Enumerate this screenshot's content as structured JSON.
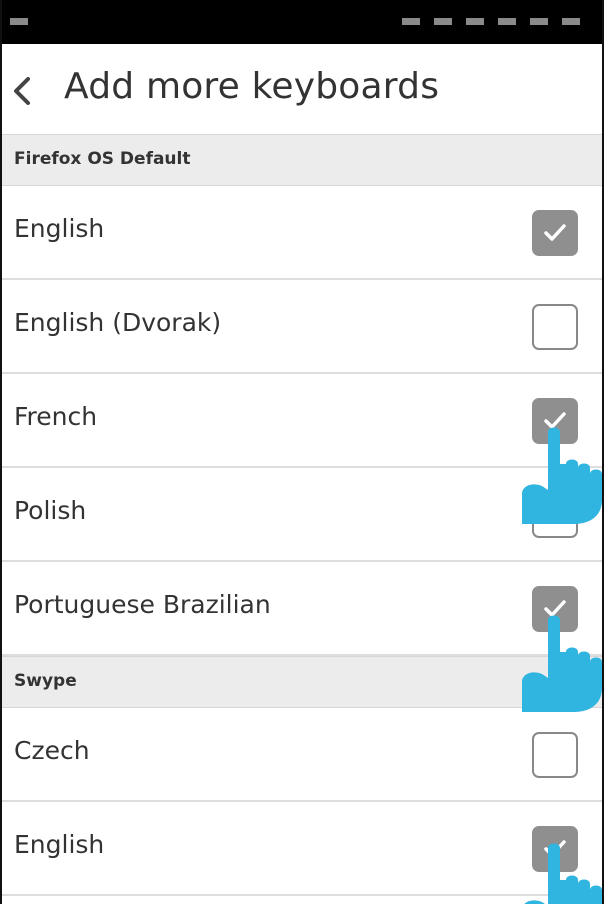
{
  "header": {
    "title": "Add more keyboards"
  },
  "sections": [
    {
      "label": "Firefox OS Default"
    },
    {
      "label": "Swype"
    }
  ],
  "rows": [
    {
      "label": "English",
      "checked": true
    },
    {
      "label": "English (Dvorak)",
      "checked": false
    },
    {
      "label": "French",
      "checked": true
    },
    {
      "label": "Polish",
      "checked": false
    },
    {
      "label": "Portuguese Brazilian",
      "checked": true
    },
    {
      "label": "Czech",
      "checked": false
    },
    {
      "label": "English",
      "checked": true
    }
  ],
  "colors": {
    "checkbox_on": "#8f8f8f",
    "pointer": "#2fb5e0",
    "statusbar": "#000000"
  },
  "icons": {
    "back": "chevron-left-icon",
    "check": "checkmark-icon",
    "pointer": "hand-pointer-icon"
  }
}
